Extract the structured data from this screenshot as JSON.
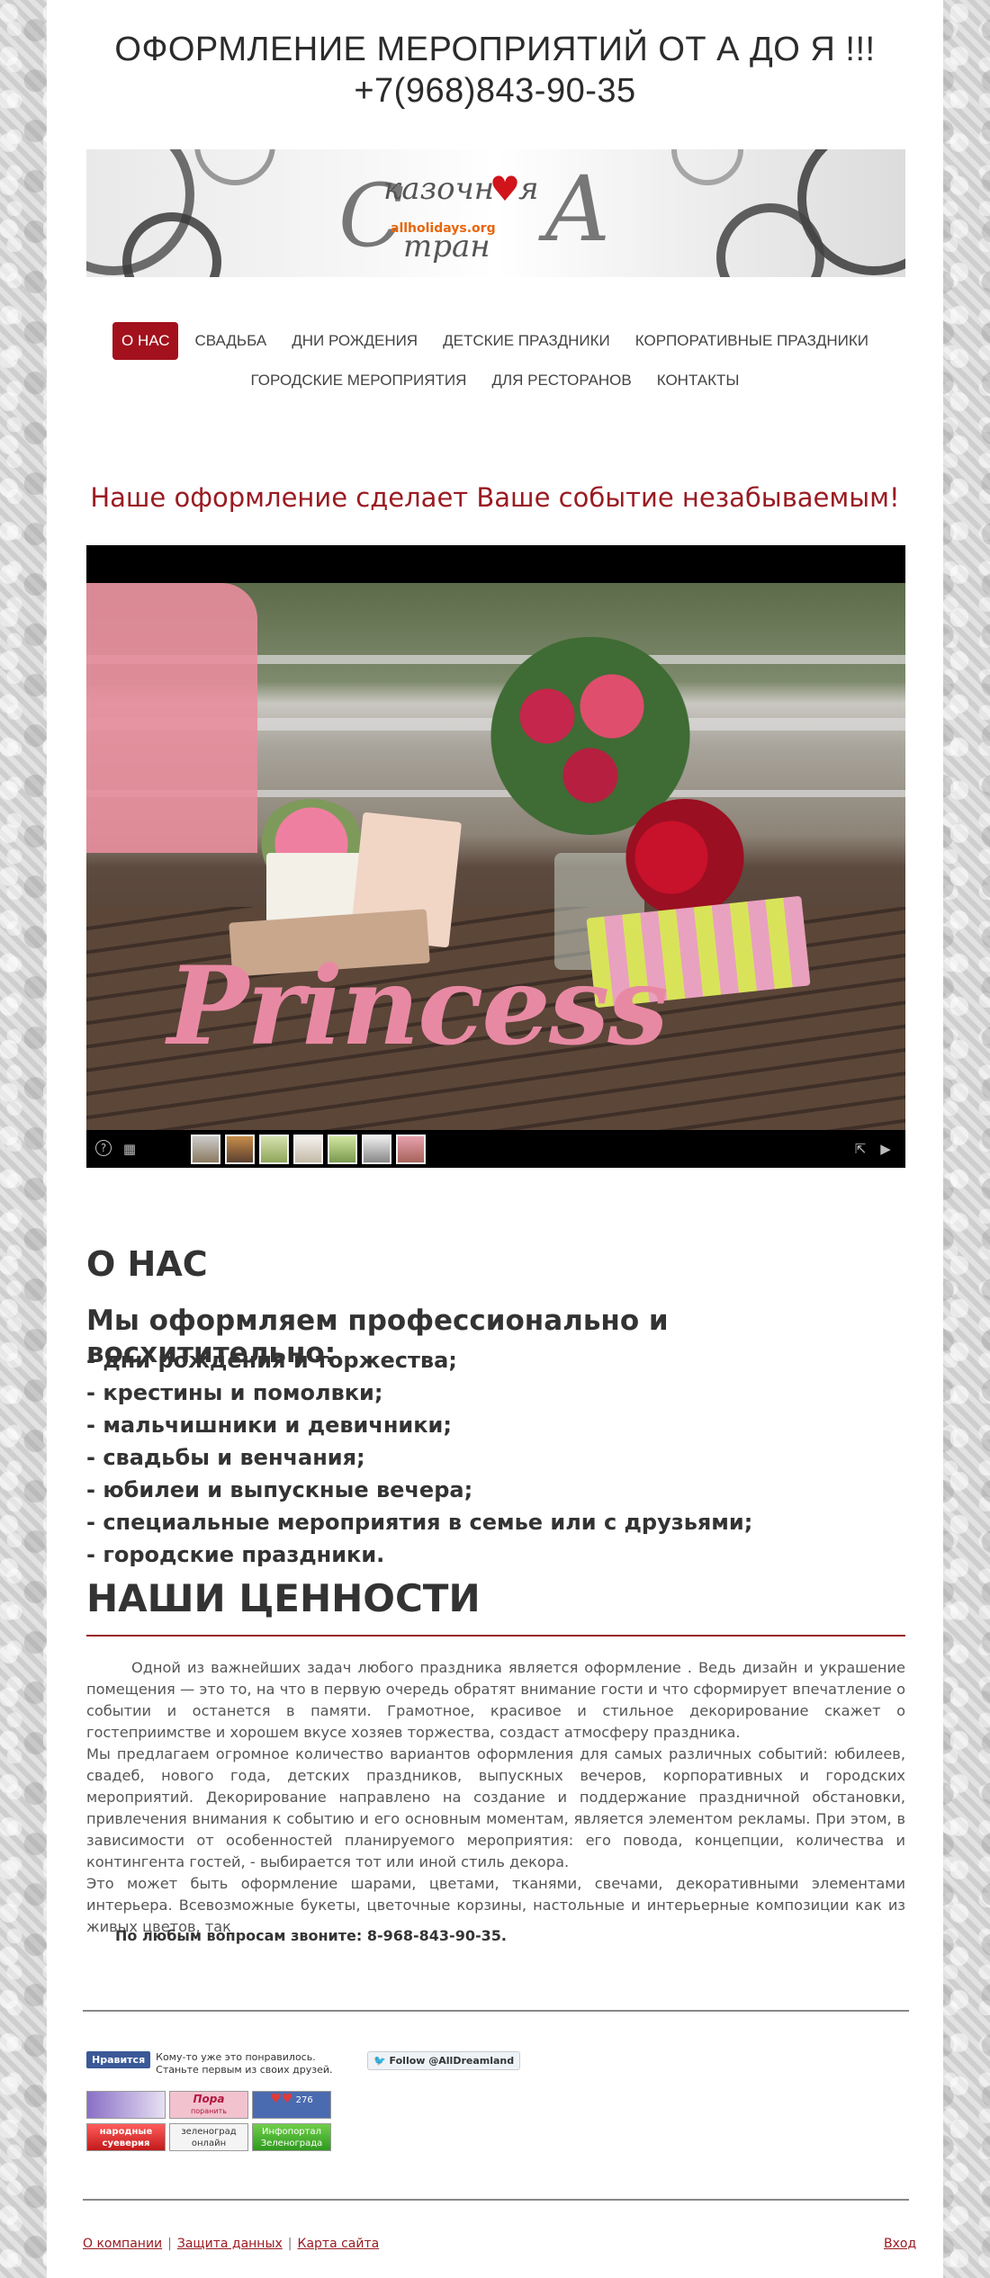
{
  "header": {
    "title_line1": "ОФОРМЛЕНИЕ МЕРОПРИЯТИЙ ОТ А ДО Я !!!",
    "title_line2": "+7(968)843-90-35"
  },
  "logo": {
    "word1_start": "С",
    "word1_rest": "казочн",
    "word1_end": "я",
    "word2_rest": "тран",
    "big_letter": "А",
    "url": "allholidays.org"
  },
  "nav": {
    "row1": [
      "О НАС",
      "СВАДЬБА",
      "ДНИ РОЖДЕНИЯ",
      "ДЕТСКИЕ ПРАЗДНИКИ",
      "КОРПОРАТИВНЫЕ ПРАЗДНИКИ"
    ],
    "row2": [
      "ГОРОДСКИЕ МЕРОПРИЯТИЯ",
      "ДЛЯ РЕСТОРАНОВ",
      "КОНТАКТЫ"
    ],
    "active": "О НАС"
  },
  "tagline": "Наше оформление сделает Ваше событие незабываемым!",
  "slider": {
    "photo_word": "Princess",
    "thumbnail_count": 7,
    "help_icon": "help-icon",
    "grid_icon": "grid-icon",
    "fullscreen_icon": "fullscreen-icon",
    "play_icon": "play-icon"
  },
  "about": {
    "heading": "О НАС",
    "subheading": "Мы оформляем профессионально и восхитительно:",
    "items": [
      "- дни рождения и торжества;",
      "- крестины и помолвки;",
      "- мальчишники и девичники;",
      "- свадьбы и венчания;",
      "- юбилеи и выпускные вечера;",
      "- специальные мероприятия в семье или с друзьями;",
      "- городские праздники."
    ]
  },
  "values": {
    "heading": "НАШИ ЦЕННОСТИ",
    "paragraphs": [
      "Одной из важнейших задач любого праздника является оформление . Ведь дизайн и украшение помещения — это то, на что в первую очередь обратят внимание гости и что сформирует впечатление о событии и останется в памяти. Грамотное, красивое и стильное декорирование скажет о гостеприимстве и хорошем вкусе хозяев торжества, создаст атмосферу праздника.",
      "Мы предлагаем огромное количество вариантов оформления для самых различных событий: юбилеев, свадеб, нового года, детских праздников, выпускных вечеров, корпоративных и городских мероприятий. Декорирование направлено на создание и поддержание праздничной обстановки, привлечения внимания к событию и его основным моментам, является элементом рекламы. При этом, в зависимости от особенностей планируемого мероприятия: его повода, концепции, количества и контингента гостей, - выбирается тот или иной стиль декора.",
      "Это может быть оформление шарами, цветами, тканями, свечами, декоративными элементами интерьера. Всевозможные букеты, цветочные корзины, настольные и интерьерные композиции как из живых цветов, так"
    ],
    "callout": "По любым вопросам звоните: 8-968-843-90-35."
  },
  "social": {
    "fb_button": "Нравится",
    "fb_text": "Кому-то уже это понравилось. Станьте первым из своих друзей.",
    "twitter": "Follow @AllDreamland"
  },
  "badges": {
    "b1_line1": "",
    "b2_line1": "Пора",
    "b2_line2": "поранить",
    "b2_num": "276",
    "b3_num": "276",
    "b4_line1": "народные",
    "b4_line2": "суеверия",
    "b5_line1": "зеленоград",
    "b5_line2": "онлайн",
    "b6_line1": "Инфопортал",
    "b6_line2": "Зеленограда"
  },
  "footer": {
    "links": [
      "О компании",
      "Защита данных",
      "Карта сайта"
    ],
    "login": "Вход"
  },
  "colors": {
    "accent": "#9a1b22",
    "active_nav": "#a3111d",
    "text": "#333333"
  }
}
